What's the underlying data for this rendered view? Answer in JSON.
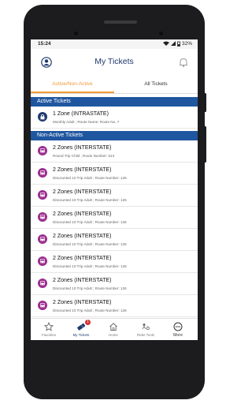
{
  "status": {
    "time": "15:24",
    "battery": "32%"
  },
  "header": {
    "title": "My Tickets"
  },
  "tabs": [
    {
      "label": "Active/Non-Active"
    },
    {
      "label": "All Tickets"
    }
  ],
  "sections": {
    "active": "Active Tickets",
    "non_active": "Non-Active Tickets"
  },
  "active_tickets": [
    {
      "name": "1 Zone (INTRASTATE)",
      "desc": "Monthly Adult ; Route Name: Route No. 7"
    }
  ],
  "non_active_tickets": [
    {
      "name": "2 Zones (INTERSTATE)",
      "desc": "Round Trip Child ; Route Number: 513"
    },
    {
      "name": "2 Zones (INTERSTATE)",
      "desc": "Discounted 10 Trip Adult ; Route Number: 126"
    },
    {
      "name": "2 Zones (INTERSTATE)",
      "desc": "Discounted 10 Trip Adult ; Route Number: 126"
    },
    {
      "name": "2 Zones (INTERSTATE)",
      "desc": "Discounted 10 Trip Adult ; Route Number: 126"
    },
    {
      "name": "2 Zones (INTERSTATE)",
      "desc": "Discounted 10 Trip Adult ; Route Number: 126"
    },
    {
      "name": "2 Zones (INTERSTATE)",
      "desc": "Discounted 10 Trip Adult ; Route Number: 126"
    },
    {
      "name": "2 Zones (INTERSTATE)",
      "desc": "Discounted 10 Trip Adult ; Route Number: 126"
    },
    {
      "name": "2 Zones (INTERSTATE)",
      "desc": "Discounted 10 Trip Adult ; Route Number: 126"
    }
  ],
  "nav": [
    {
      "label": "Favorites",
      "icon": "star-icon"
    },
    {
      "label": "My Tickets",
      "icon": "ticket-icon",
      "badge": "1"
    },
    {
      "label": "Home",
      "icon": "home-icon"
    },
    {
      "label": "Rider Tools",
      "icon": "rider-tools-icon"
    },
    {
      "label": "More",
      "icon": "more-icon"
    }
  ],
  "colors": {
    "brand_blue": "#1f56a0",
    "title_navy": "#1f3a6e",
    "accent_orange": "#f29a38",
    "active_icon": "#1f3a6e",
    "non_active_icon": "#9b2e8e",
    "badge_red": "#d32f2f"
  }
}
